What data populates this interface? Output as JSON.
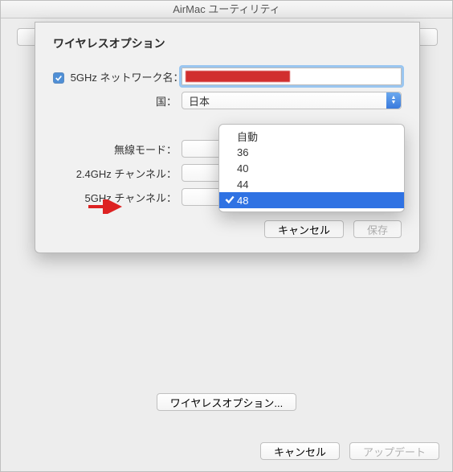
{
  "window": {
    "title": "AirMac ユーティリティ"
  },
  "sheet": {
    "title": "ワイヤレスオプション",
    "network_name_label": "5GHz ネットワーク名：",
    "network_name_checked": true,
    "country_label": "国：",
    "country_value": "日本",
    "wireless_mode_label": "無線モード：",
    "channel24_label": "2.4GHz チャンネル：",
    "channel5_label": "5GHz チャンネル：",
    "cancel": "キャンセル",
    "save": "保存"
  },
  "dropdown": {
    "items": [
      {
        "label": "自動",
        "selected": false
      },
      {
        "label": "36",
        "selected": false
      },
      {
        "label": "40",
        "selected": false
      },
      {
        "label": "44",
        "selected": false
      },
      {
        "label": "48",
        "selected": true
      }
    ]
  },
  "footer": {
    "wireless_options": "ワイヤレスオプション...",
    "cancel": "キャンセル",
    "update": "アップデート"
  }
}
